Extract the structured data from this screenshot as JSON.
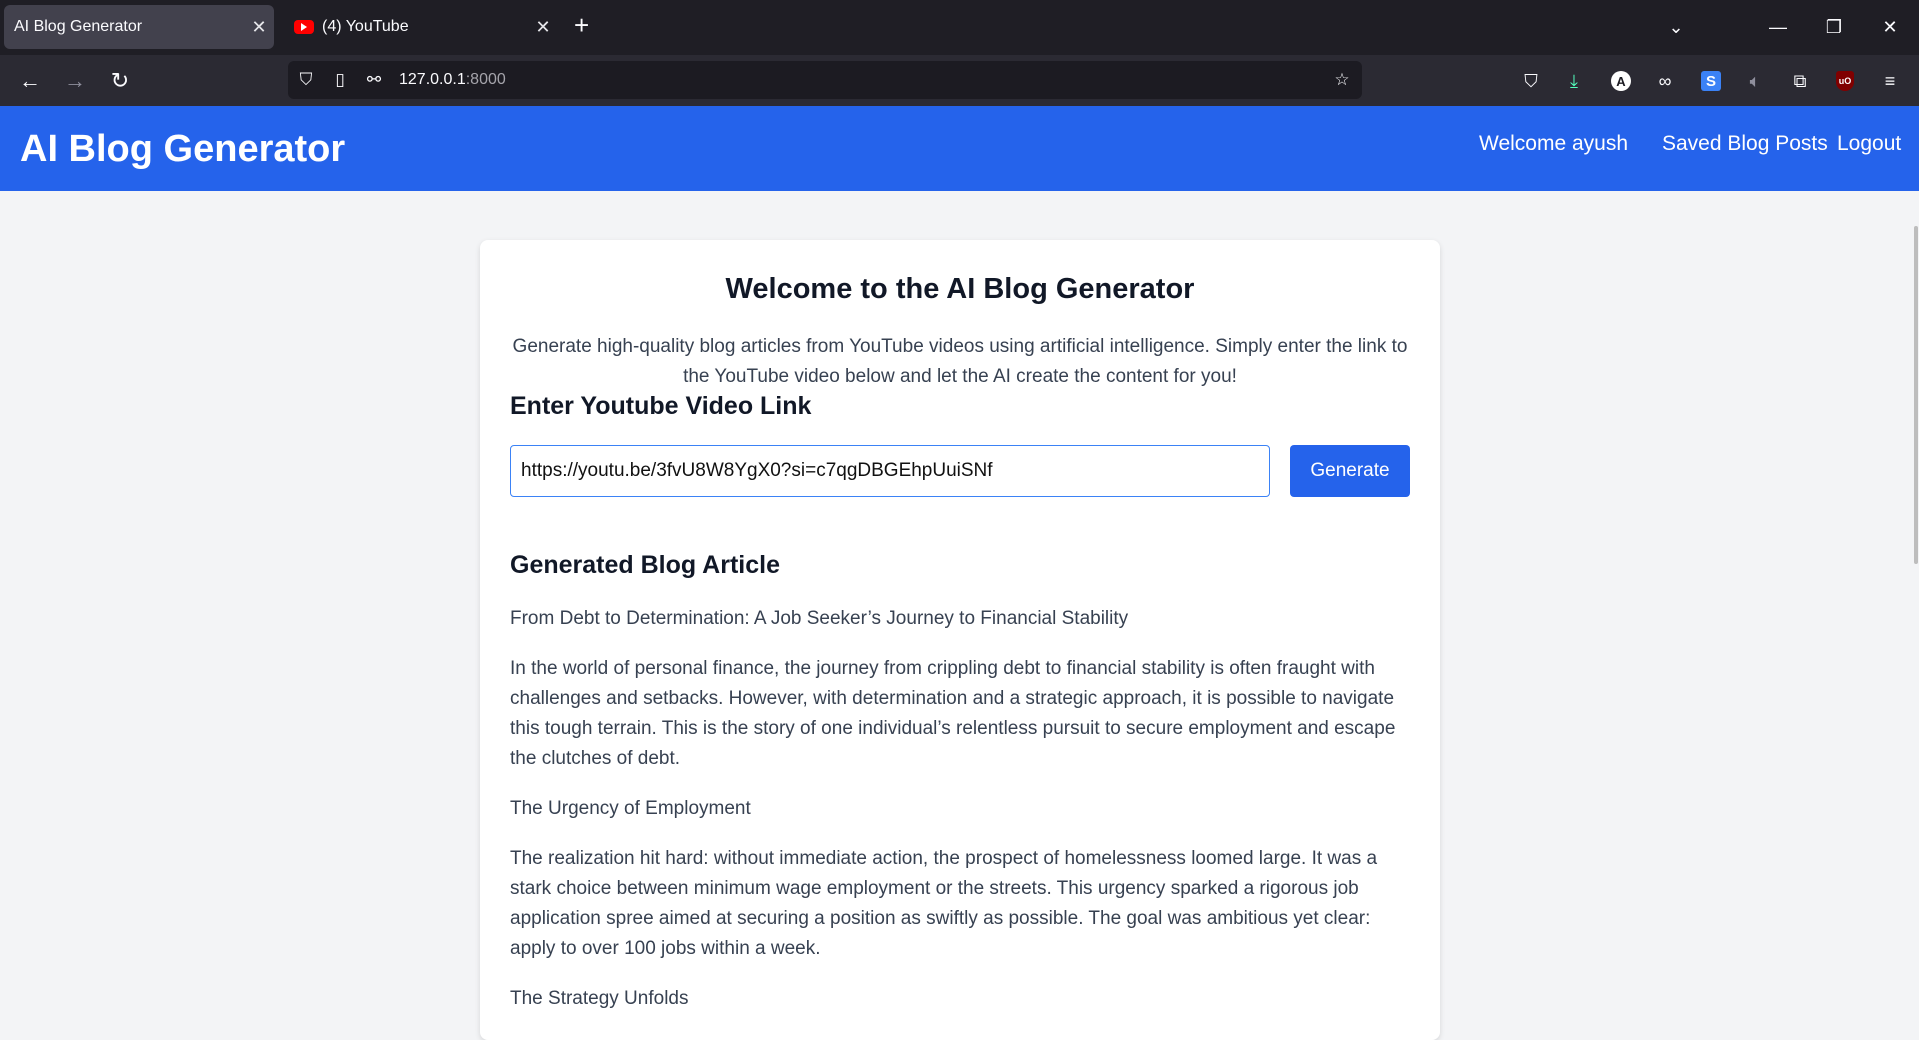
{
  "browser": {
    "tabs": [
      {
        "title": "AI Blog Generator",
        "active": true
      },
      {
        "title": "(4) YouTube",
        "active": false,
        "favicon": "youtube-icon"
      }
    ],
    "url_host": "127.0.0.1",
    "url_port": ":8000",
    "extensions": [
      "pocket-icon",
      "download-icon",
      "a-extension-icon",
      "incognito-mask-icon",
      "s-extension-icon",
      "speaker-icon",
      "puzzle-icon",
      "ublock-icon",
      "menu-icon"
    ],
    "ext_labels": {
      "a": "A",
      "s": "S",
      "ub": "uO"
    },
    "accent": "#2563eb"
  },
  "header": {
    "brand": "AI Blog Generator",
    "welcome": "Welcome ayush",
    "saved": "Saved Blog Posts",
    "logout": "Logout"
  },
  "main": {
    "title": "Welcome to the AI Blog Generator",
    "intro": "Generate high-quality blog articles from YouTube videos using artificial intelligence. Simply enter the link to the YouTube video below and let the AI create the content for you!",
    "input_heading": "Enter Youtube Video Link",
    "input_value": "https://youtu.be/3fvU8W8YgX0?si=c7qgDBGEhpUuiSNf",
    "generate_label": "Generate",
    "article_heading": "Generated Blog Article",
    "article": [
      "From Debt to Determination: A Job Seeker’s Journey to Financial Stability",
      "In the world of personal finance, the journey from crippling debt to financial stability is often fraught with challenges and setbacks. However, with determination and a strategic approach, it is possible to navigate this tough terrain. This is the story of one individual’s relentless pursuit to secure employment and escape the clutches of debt.",
      "The Urgency of Employment",
      "The realization hit hard: without immediate action, the prospect of homelessness loomed large. It was a stark choice between minimum wage employment or the streets. This urgency sparked a rigorous job application spree aimed at securing a position as swiftly as possible. The goal was ambitious yet clear: apply to over 100 jobs within a week.",
      "The Strategy Unfolds"
    ]
  }
}
